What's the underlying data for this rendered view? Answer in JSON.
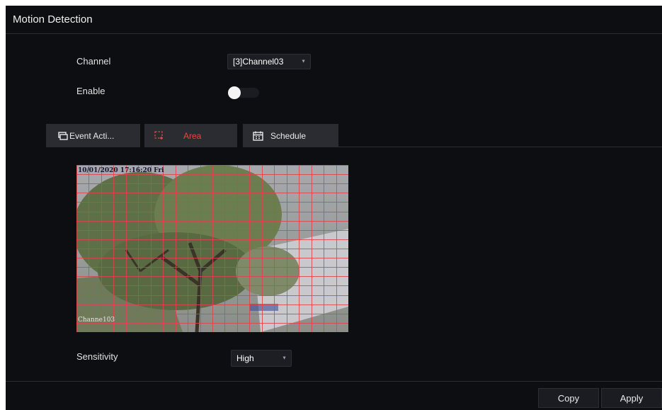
{
  "page": {
    "title": "Motion Detection"
  },
  "channel": {
    "label": "Channel",
    "value": "[3]Channel03"
  },
  "enable": {
    "label": "Enable",
    "on": true
  },
  "tabs": [
    {
      "label": "Event Acti...",
      "icon": "event-action-icon",
      "active": false
    },
    {
      "label": "Area",
      "icon": "area-select-icon",
      "active": true
    },
    {
      "label": "Schedule",
      "icon": "calendar-icon",
      "active": false
    }
  ],
  "preview": {
    "timestamp": "10/01/2020 17:16:20 Fri",
    "channel_overlay": "Channe103",
    "grid_color": "#e0424a"
  },
  "sensitivity": {
    "label": "Sensitivity",
    "value": "High"
  },
  "buttons": {
    "copy": "Copy",
    "apply": "Apply"
  },
  "colors": {
    "accent": "#e14a40",
    "background": "#0d0e12",
    "tab": "#2a2c31"
  }
}
